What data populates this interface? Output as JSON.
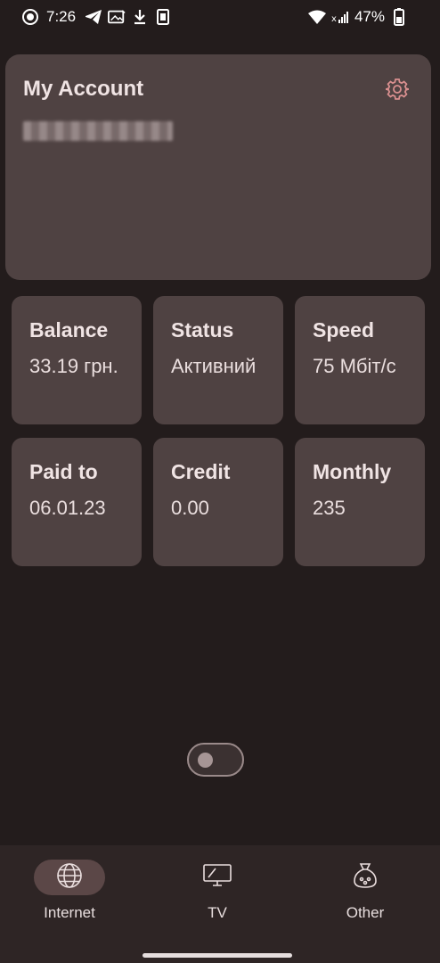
{
  "status_bar": {
    "time": "7:26",
    "battery": "47%",
    "left_icons": [
      "record-icon",
      "telegram-icon",
      "image-icon",
      "download-icon",
      "sim-icon"
    ],
    "right_icons": [
      "wifi-icon",
      "signal-icon",
      "battery-icon"
    ]
  },
  "account": {
    "title": "My Account",
    "settings_icon": "gear-icon"
  },
  "tiles": [
    {
      "label": "Balance",
      "value": "33.19 грн."
    },
    {
      "label": "Status",
      "value": "Активний"
    },
    {
      "label": "Speed",
      "value": "75 Мбіт/с"
    },
    {
      "label": "Paid to",
      "value": "06.01.23"
    },
    {
      "label": "Credit",
      "value": "0.00"
    },
    {
      "label": "Monthly",
      "value": "235"
    }
  ],
  "toggle": {
    "state": "off"
  },
  "nav": {
    "items": [
      {
        "label": "Internet",
        "icon": "globe-icon",
        "active": true
      },
      {
        "label": "TV",
        "icon": "tv-icon",
        "active": false
      },
      {
        "label": "Other",
        "icon": "bag-icon",
        "active": false
      }
    ]
  },
  "colors": {
    "background": "#231c1c",
    "card": "#4f4242",
    "nav_background": "#2e2525",
    "active_pill": "#5b4747"
  }
}
